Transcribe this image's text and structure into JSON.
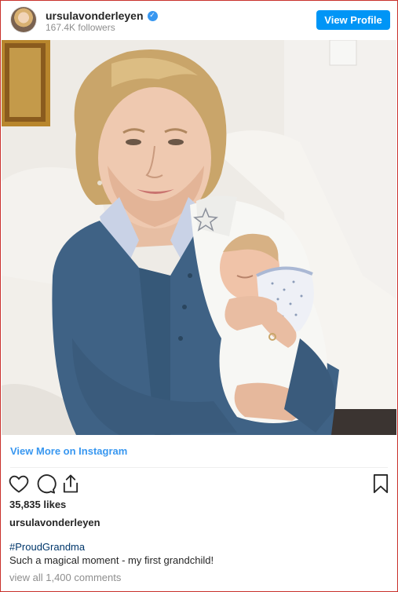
{
  "header": {
    "username": "ursulavonderleyen",
    "verified_glyph": "✓",
    "followers": "167.4K followers",
    "view_profile_label": "View Profile"
  },
  "post": {
    "image_icon": "photo-woman-holding-newborn",
    "view_more_label": "View More on Instagram",
    "likes": "35,835 likes",
    "caption_username": "ursulavonderleyen",
    "hashtag": "#ProudGrandma",
    "caption": "Such a magical moment - my first grandchild!",
    "comments_link": "view all 1,400 comments"
  },
  "icons": {
    "like": "heart-icon",
    "comment": "comment-icon",
    "share": "share-icon",
    "save": "bookmark-icon"
  },
  "colors": {
    "accent": "#0095f6",
    "link": "#3897f0",
    "hashtag": "#00376b",
    "muted": "#8e8e8e",
    "border": "#c9302c"
  }
}
